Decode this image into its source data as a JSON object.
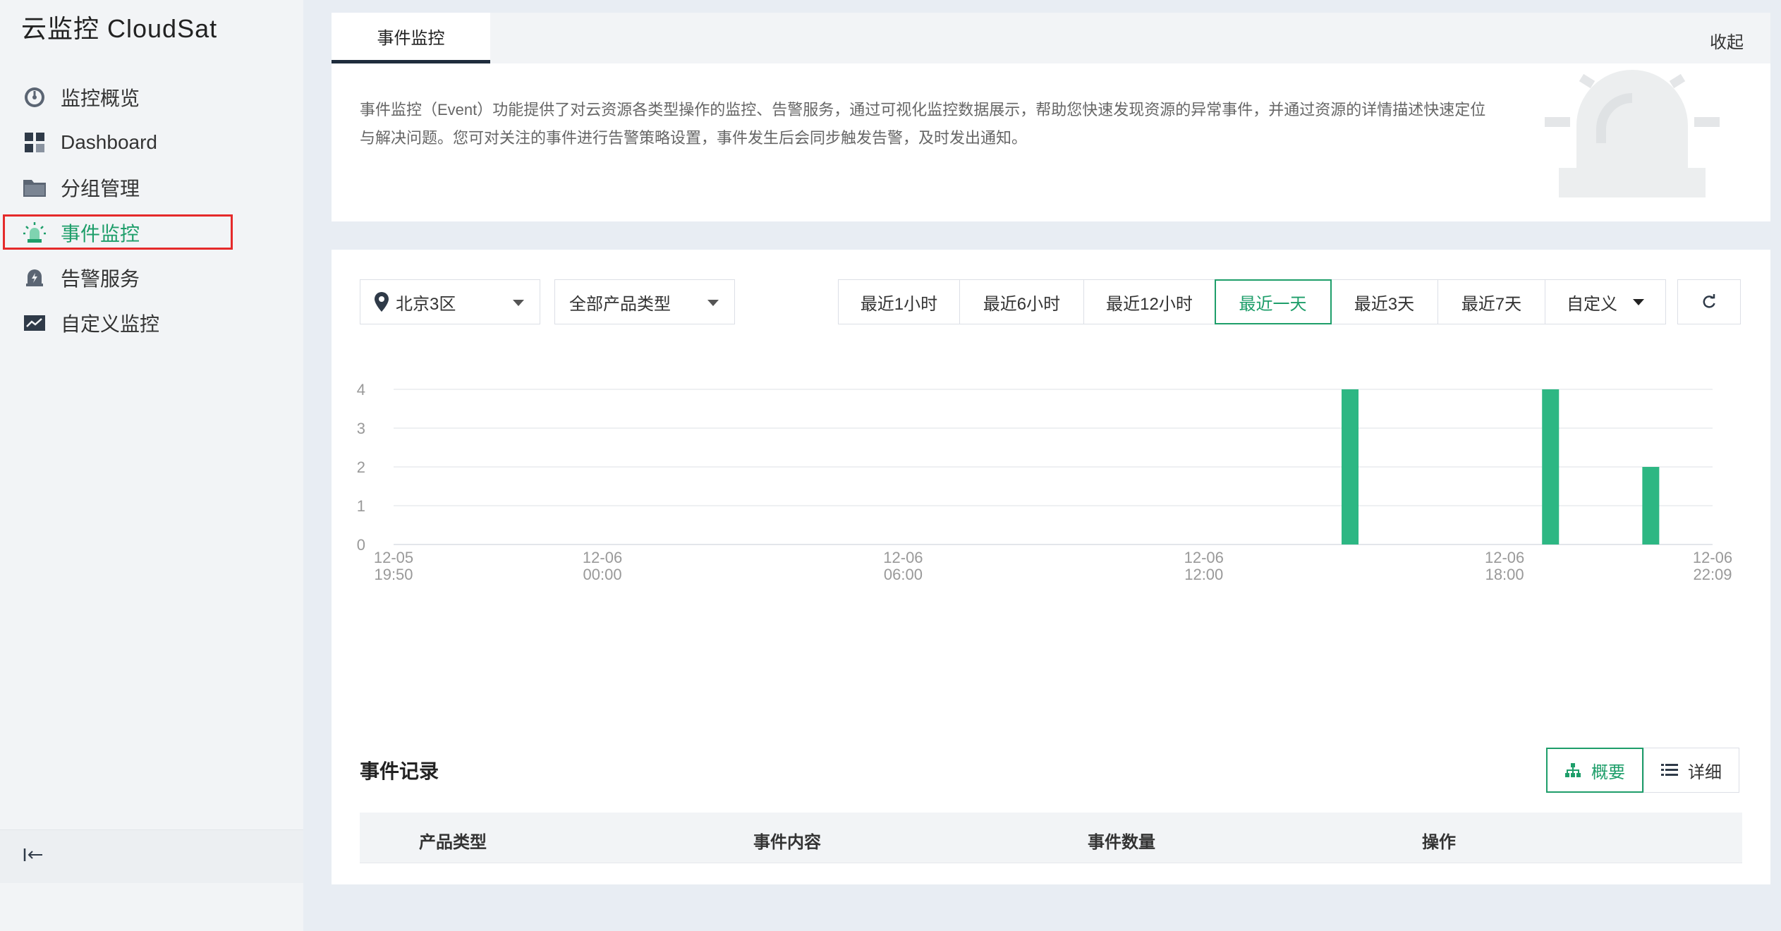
{
  "app": {
    "title": "云监控 CloudSat"
  },
  "sidebar": {
    "items": [
      {
        "label": "监控概览",
        "icon": "dashboard-gauge-icon"
      },
      {
        "label": "Dashboard",
        "icon": "grid-icon"
      },
      {
        "label": "分组管理",
        "icon": "folder-icon"
      },
      {
        "label": "事件监控",
        "icon": "alarm-light-icon",
        "active": true
      },
      {
        "label": "告警服务",
        "icon": "alert-bell-icon"
      },
      {
        "label": "自定义监控",
        "icon": "trend-chart-icon"
      }
    ],
    "collapse_icon": "collapse-left-icon"
  },
  "header": {
    "tab": "事件监控",
    "collapse_label": "收起",
    "description": "事件监控（Event）功能提供了对云资源各类型操作的监控、告警服务，通过可视化监控数据展示，帮助您快速发现资源的异常事件，并通过资源的详情描述快速定位与解决问题。您可对关注的事件进行告警策略设置，事件发生后会同步触发告警，及时发出通知。"
  },
  "filters": {
    "region": "北京3区",
    "product_type": "全部产品类型",
    "time_ranges": [
      "最近1小时",
      "最近6小时",
      "最近12小时",
      "最近一天",
      "最近3天",
      "最近7天",
      "自定义"
    ],
    "active_time_range": "最近一天"
  },
  "chart_data": {
    "type": "bar",
    "x_ticks": [
      {
        "date": "12-05",
        "time": "19:50"
      },
      {
        "date": "12-06",
        "time": "00:00"
      },
      {
        "date": "12-06",
        "time": "06:00"
      },
      {
        "date": "12-06",
        "time": "12:00"
      },
      {
        "date": "12-06",
        "time": "18:00"
      },
      {
        "date": "12-06",
        "time": "22:09"
      }
    ],
    "x_range": [
      "12-05 19:50",
      "12-06 22:09"
    ],
    "y_ticks": [
      0,
      1,
      2,
      3,
      4
    ],
    "ylim": [
      0,
      4
    ],
    "bars": [
      {
        "x": "12-06 14:55",
        "value": 4
      },
      {
        "x": "12-06 18:55",
        "value": 4
      },
      {
        "x": "12-06 20:55",
        "value": 2
      }
    ],
    "bar_color": "#2db783",
    "grid": true
  },
  "records": {
    "title": "事件记录",
    "view_options": [
      "概要",
      "详细"
    ],
    "active_view": "概要",
    "columns": [
      "产品类型",
      "事件内容",
      "事件数量",
      "操作"
    ]
  },
  "colors": {
    "accent": "#1e9e6a",
    "highlight_box": "#e52a2a"
  }
}
